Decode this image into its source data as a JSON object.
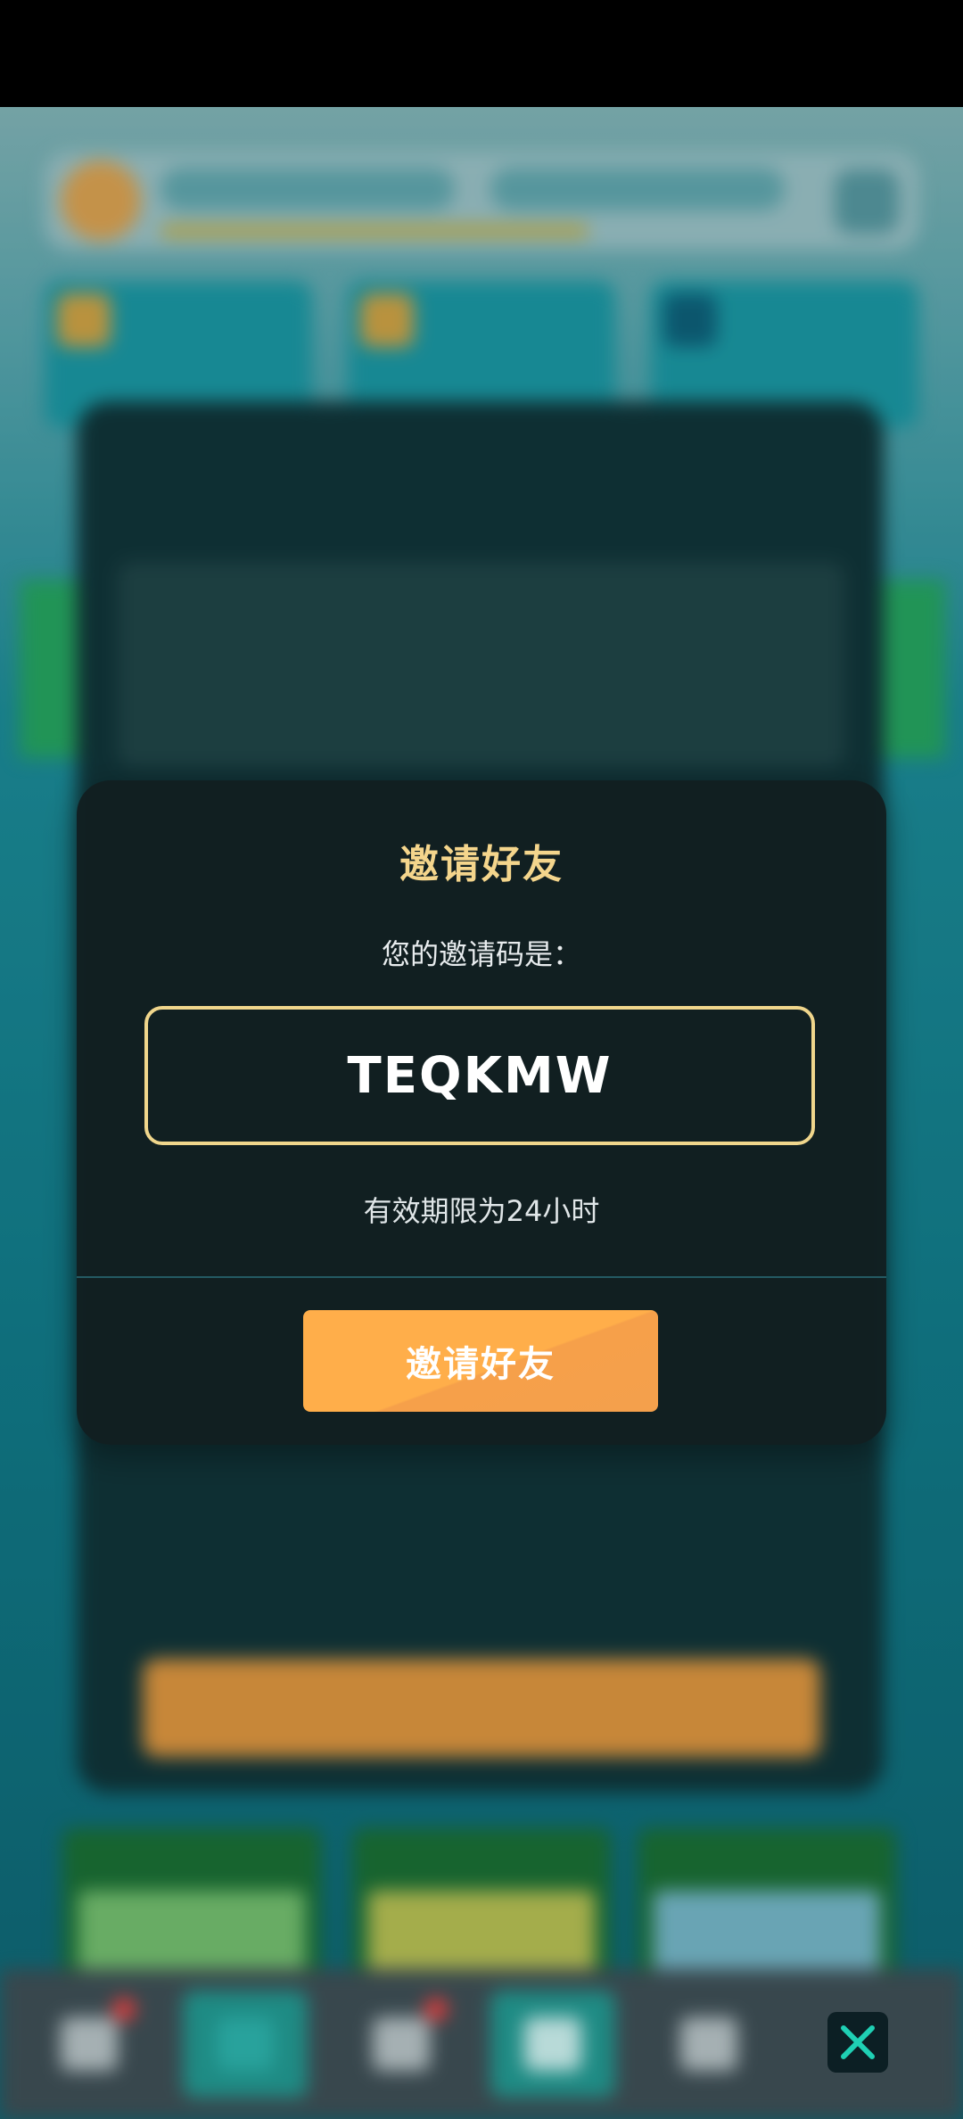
{
  "dialog": {
    "title": "邀请好友",
    "subtitle": "您的邀请码是：",
    "invite_code": "TEQKMW",
    "validity": "有效期限为24小时",
    "invite_button_label": "邀请好友"
  },
  "bottom_nav": {
    "items": [
      {
        "icon": "triangle-icon",
        "badge": true
      },
      {
        "icon": "shield-icon",
        "active": true
      },
      {
        "icon": "gear-badge-icon",
        "badge": true
      },
      {
        "icon": "diamond-icon",
        "active": true
      },
      {
        "icon": "heart-diamond-icon"
      }
    ]
  },
  "close_icon": "close-icon",
  "colors": {
    "accent_gold": "#f4d58c",
    "button_orange": "#ffae4a",
    "dialog_bg": "#121e20",
    "close_x": "#1fd0b4"
  }
}
